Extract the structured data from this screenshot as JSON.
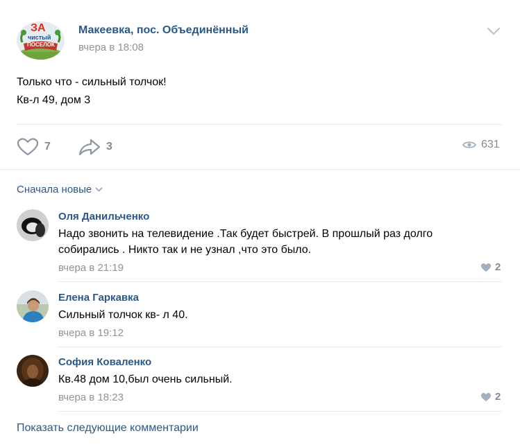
{
  "post": {
    "group_name": "Макеевка, пос. Объединённый",
    "time": "вчера в 18:08",
    "logo_text": [
      "ЗА",
      "чистый",
      "поселок"
    ],
    "text_lines": [
      "Только что - сильный толчок!",
      "Кв-л 49, дом 3"
    ],
    "likes": "7",
    "shares": "3",
    "views": "631"
  },
  "sort_label": "Сначала новые",
  "comments": [
    {
      "author": "Оля Данильченко",
      "lines": [
        "Надо звонить на телевидение .Так будет быстрей. В прошлый раз долго",
        "собирались . Никто так и не узнал ,что это было."
      ],
      "time": "вчера в 21:19",
      "likes": "2"
    },
    {
      "author": "Елена Гаркавка",
      "lines": [
        "Сильный толчок кв- л 40."
      ],
      "time": "вчера в 19:12",
      "likes": ""
    },
    {
      "author": "София Коваленко",
      "lines": [
        "Кв.48 дом 10,был очень сильный."
      ],
      "time": "вчера в 18:23",
      "likes": "2"
    }
  ],
  "show_more": "Показать следующие комментарии",
  "colors": {
    "link": "#2a5885",
    "muted": "#939393",
    "icon": "#828a99",
    "divider": "#e7e8ec"
  }
}
